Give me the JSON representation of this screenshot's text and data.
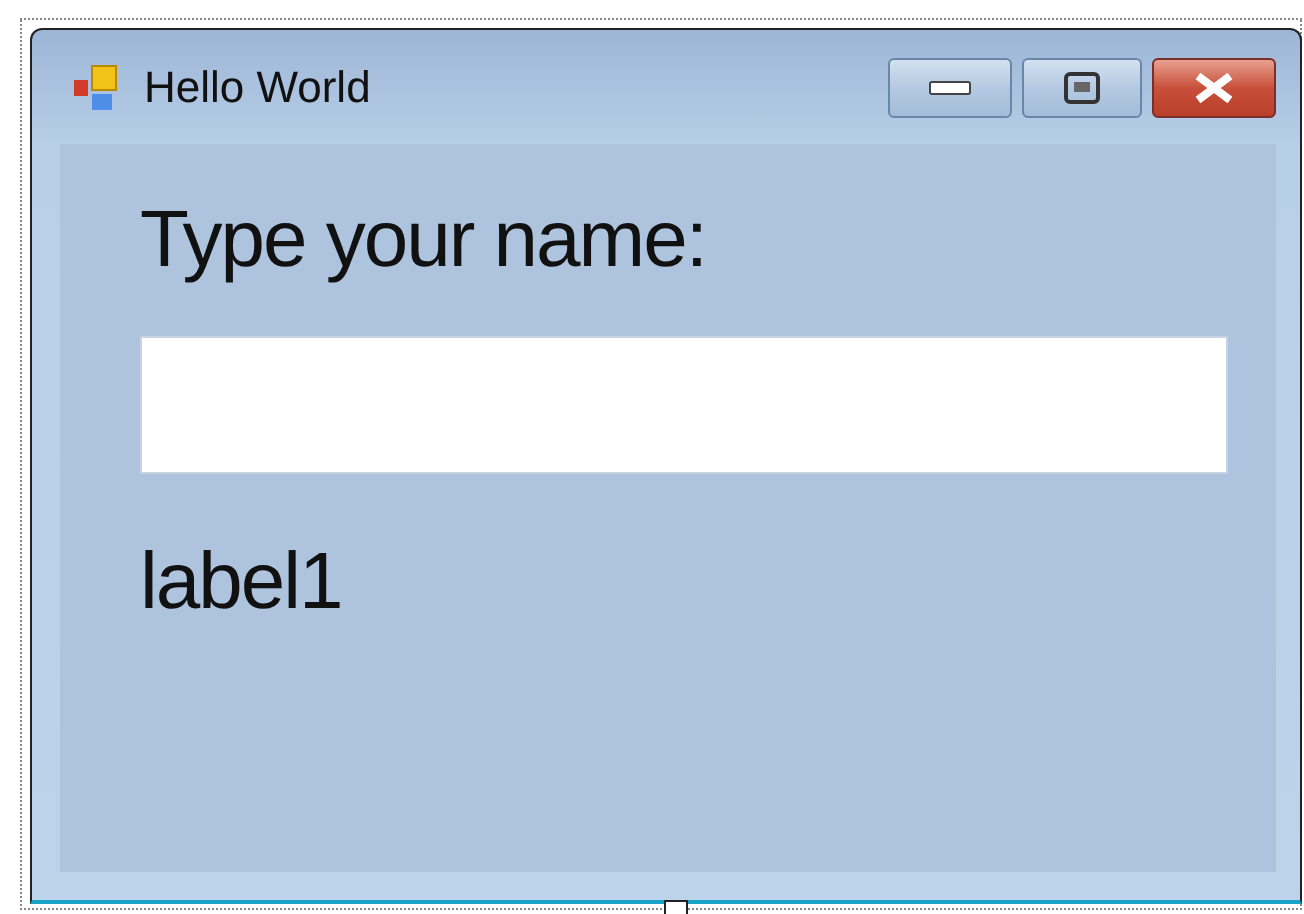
{
  "window": {
    "title": "Hello World"
  },
  "prompt_label": "Type your name:",
  "output_label": "label1"
}
